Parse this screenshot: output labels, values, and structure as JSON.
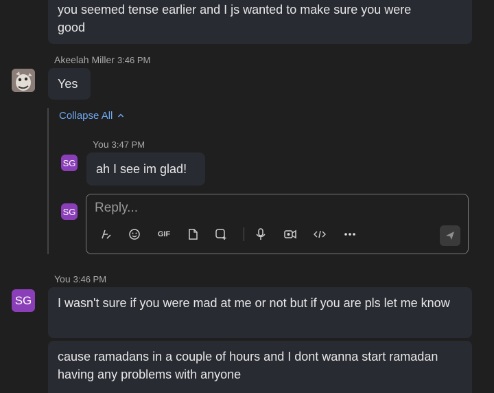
{
  "messages": {
    "top": {
      "text": "you seemed tense earlier and I js wanted to make sure you were good"
    },
    "akeelah": {
      "name": "Akeelah Miller",
      "time": "3:46 PM",
      "text": "Yes"
    },
    "thread": {
      "collapse_label": "Collapse All",
      "reply": {
        "name": "You",
        "time": "3:47 PM",
        "initials": "SG",
        "text": "ah I see im glad!"
      },
      "composer": {
        "initials": "SG",
        "placeholder": "Reply...",
        "gif_label": "GIF"
      }
    },
    "you_group": {
      "name": "You",
      "time": "3:46 PM",
      "initials": "SG",
      "msg1": "I wasn't sure if you were mad at me or not but if you are pls let me know",
      "msg2": "cause ramadans in a couple of hours and I dont wanna start ramadan having any problems with anyone"
    }
  },
  "colors": {
    "background": "#1f1f1f",
    "bubble": "#292b33",
    "accent_link": "#6fa8f0",
    "avatar_sg": "#8a3fb8"
  },
  "icons": [
    "format-text-icon",
    "emoji-icon",
    "gif-icon",
    "attach-file-icon",
    "loop-component-icon",
    "microphone-icon",
    "video-clip-icon",
    "code-icon",
    "more-options-icon",
    "send-icon",
    "collapse-chevron-icon"
  ]
}
